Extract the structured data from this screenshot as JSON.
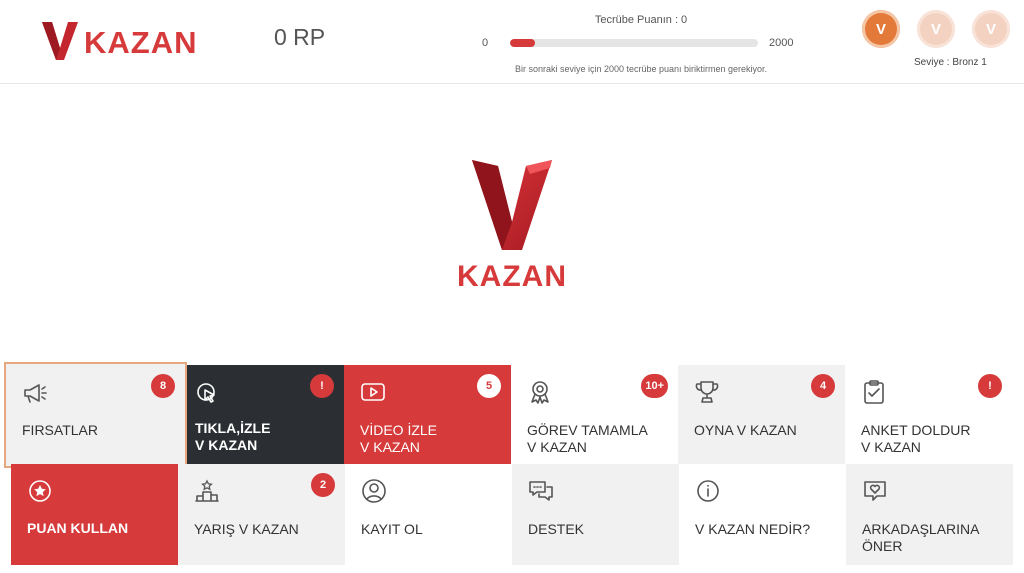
{
  "header": {
    "brand": "KAZAN",
    "rp": "0 RP",
    "xp": {
      "title": "Tecrübe Puanın : 0",
      "min": "0",
      "max": "2000",
      "progress": 0.1,
      "note": "Bir sonraki seviye için 2000 tecrübe puanı biriktirmen gerekiyor."
    },
    "badges": [
      {
        "letter": "V",
        "state": "active",
        "icon": "bronze-medal-icon"
      },
      {
        "letter": "V",
        "state": "inactive",
        "icon": "silver-medal-icon"
      },
      {
        "letter": "V",
        "state": "inactive",
        "icon": "gold-medal-icon"
      }
    ],
    "level": "Seviye : Bronz 1"
  },
  "hero": {
    "brand": "KAZAN"
  },
  "colors": {
    "accent": "#d63a3a",
    "dark": "#2b2f33",
    "bronze": "#e37a3a"
  },
  "tiles": [
    {
      "label": "FIRSATLAR",
      "count": "8",
      "icon": "megaphone-icon"
    },
    {
      "label": "TIKLA,İZLE\nV KAZAN",
      "count": "!",
      "icon": "click-icon"
    },
    {
      "label": "VİDEO İZLE\nV KAZAN",
      "count": "5",
      "icon": "play-icon"
    },
    {
      "label": "GÖREV TAMAMLA\nV KAZAN",
      "count": "10+",
      "icon": "award-icon"
    },
    {
      "label": "OYNA V KAZAN",
      "count": "4",
      "icon": "trophy-icon"
    },
    {
      "label": "ANKET DOLDUR\nV KAZAN",
      "count": "!",
      "icon": "clipboard-icon"
    },
    {
      "label": "PUAN KULLAN",
      "count": "",
      "icon": "star-coin-icon"
    },
    {
      "label": "YARIŞ V KAZAN",
      "count": "2",
      "icon": "podium-icon"
    },
    {
      "label": "KAYIT OL",
      "count": "",
      "icon": "user-icon"
    },
    {
      "label": "DESTEK",
      "count": "",
      "icon": "chat-icon"
    },
    {
      "label": "V KAZAN NEDİR?",
      "count": "",
      "icon": "info-icon"
    },
    {
      "label": "ARKADAŞLARINA\nÖNER",
      "count": "",
      "icon": "heart-message-icon"
    }
  ]
}
